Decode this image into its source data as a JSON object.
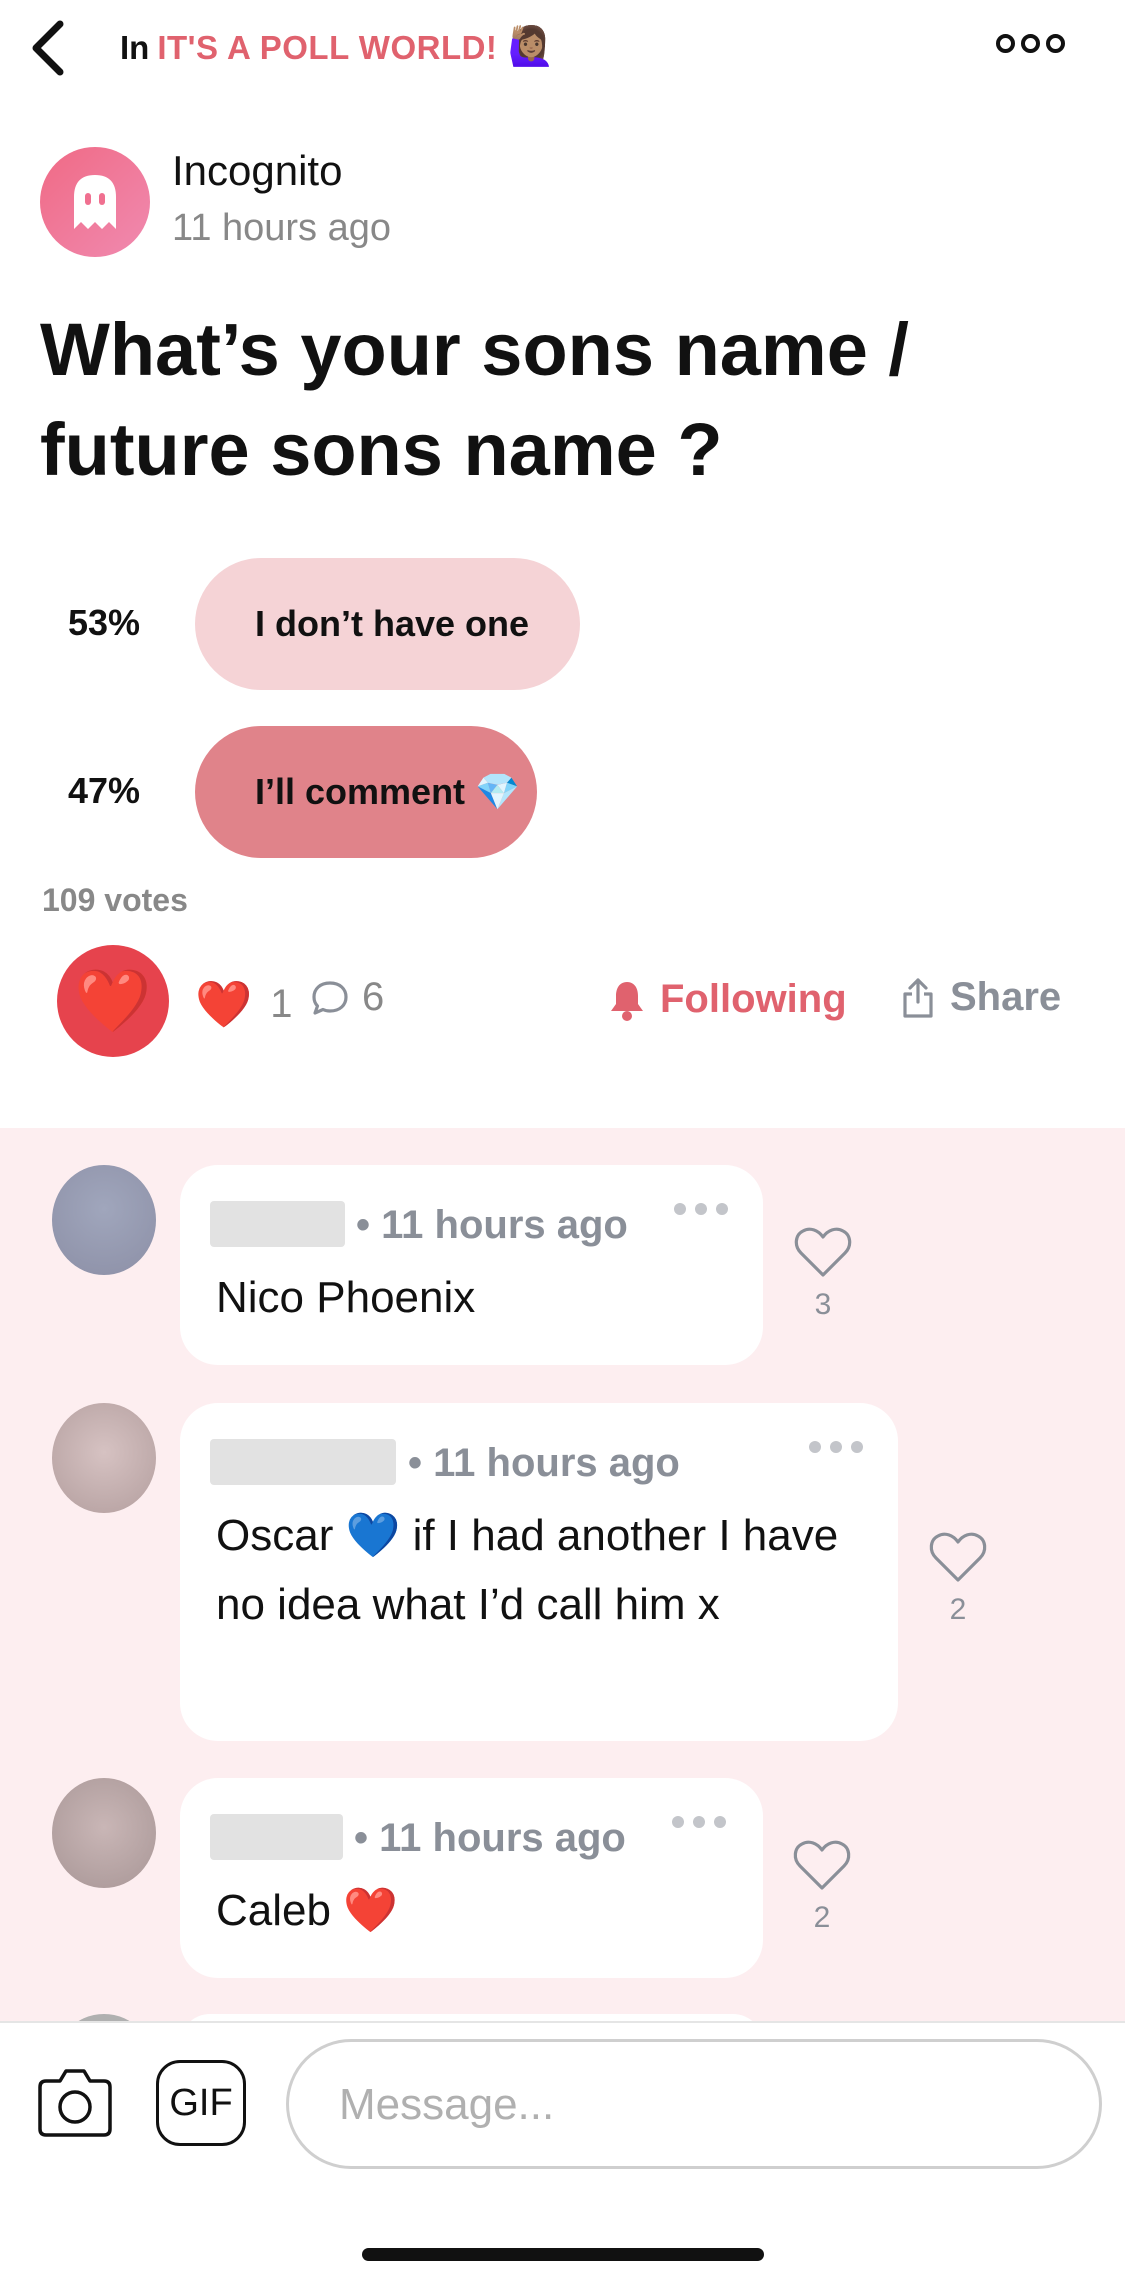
{
  "header": {
    "prefix": "In",
    "community_name": "IT'S A POLL WORLD!",
    "community_emoji": "🙋🏽‍♀️"
  },
  "post": {
    "author": "Incognito",
    "time": "11 hours ago",
    "title": "What’s your sons name / future sons name ?",
    "poll": {
      "options": [
        {
          "percent": "53%",
          "label": "I don’t have one",
          "share": 0.53
        },
        {
          "percent": "47%",
          "label": "I’ll comment 💎",
          "share": 0.47
        }
      ],
      "votes": "109 votes"
    },
    "actions": {
      "reaction_emoji": "❤️",
      "reaction_count": "1",
      "comment_count": "6",
      "following_label": "Following",
      "share_label": "Share"
    }
  },
  "comments": [
    {
      "time": "• 11 hours ago",
      "text": "Nico Phoenix",
      "likes": "3"
    },
    {
      "time": "• 11 hours ago",
      "text": "Oscar 💙 if I had another I have no idea what I’d call him x",
      "likes": "2"
    },
    {
      "time": "• 11 hours ago",
      "text": "Caleb ❤️",
      "likes": "2"
    }
  ],
  "composer": {
    "gif_label": "GIF",
    "placeholder": "Message..."
  },
  "colors": {
    "accent": "#e0626e",
    "comments_bg": "#fdeef0",
    "pill_light": "#f5d3d6",
    "pill_dark": "#e0838a"
  }
}
